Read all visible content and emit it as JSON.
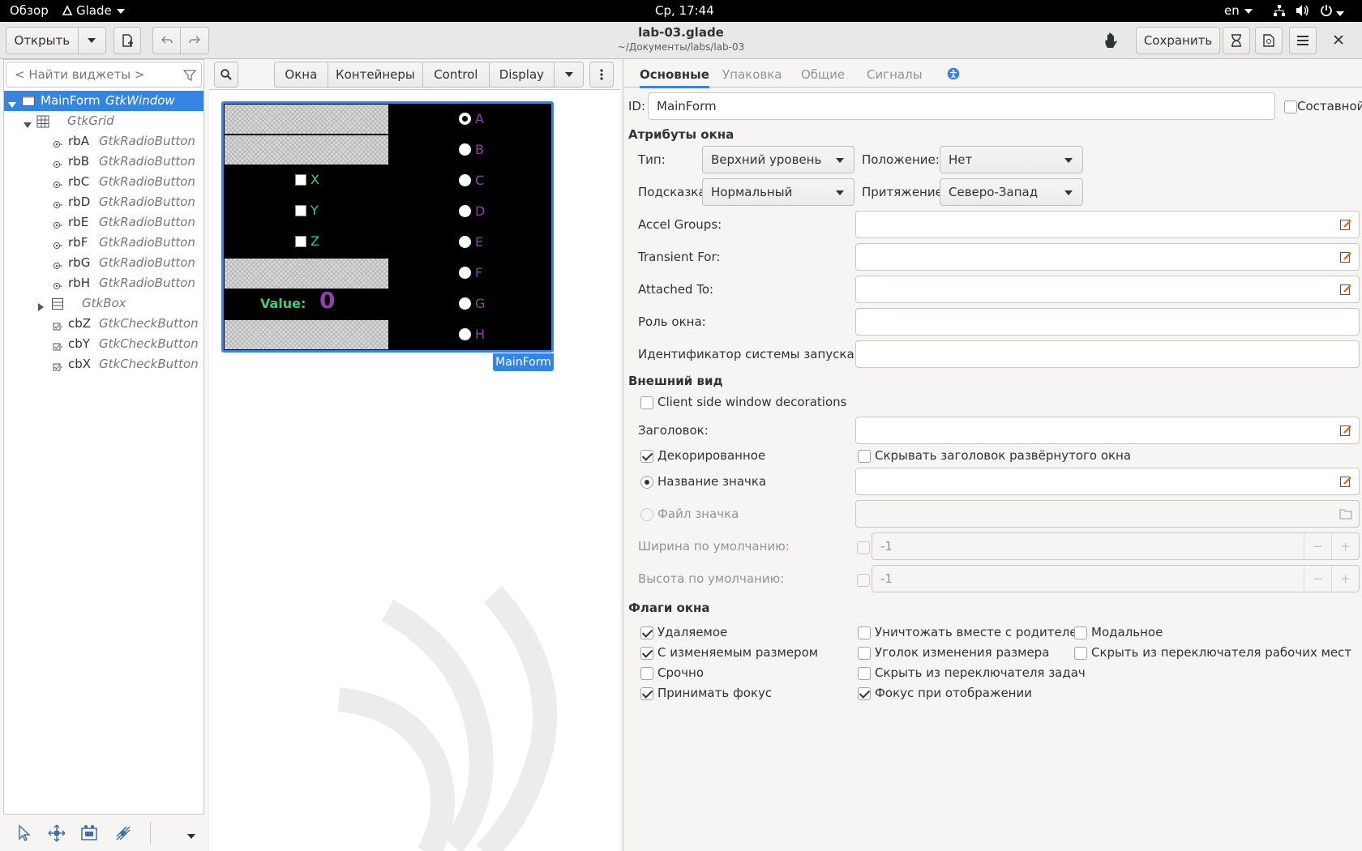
{
  "topbar": {
    "activities": "Обзор",
    "app_name": "Glade",
    "clock": "Ср, 17:44",
    "lang": "en"
  },
  "headerbar": {
    "open_label": "Открыть",
    "title": "lab-03.glade",
    "subtitle": "~/Документы/labs/lab-03",
    "save_label": "Сохранить"
  },
  "palette": {
    "search_placeholder": "< Найти виджеты >",
    "groups": [
      "Окна",
      "Контейнеры",
      "Control",
      "Display"
    ]
  },
  "tree": [
    {
      "name": "MainForm",
      "type": "GtkWindow"
    },
    {
      "name": "",
      "type": "GtkGrid"
    },
    {
      "name": "rbA",
      "type": "GtkRadioButton"
    },
    {
      "name": "rbB",
      "type": "GtkRadioButton"
    },
    {
      "name": "rbC",
      "type": "GtkRadioButton"
    },
    {
      "name": "rbD",
      "type": "GtkRadioButton"
    },
    {
      "name": "rbE",
      "type": "GtkRadioButton"
    },
    {
      "name": "rbF",
      "type": "GtkRadioButton"
    },
    {
      "name": "rbG",
      "type": "GtkRadioButton"
    },
    {
      "name": "rbH",
      "type": "GtkRadioButton"
    },
    {
      "name": "",
      "type": "GtkBox"
    },
    {
      "name": "cbZ",
      "type": "GtkCheckButton"
    },
    {
      "name": "cbY",
      "type": "GtkCheckButton"
    },
    {
      "name": "cbX",
      "type": "GtkCheckButton"
    }
  ],
  "preview": {
    "checks": [
      "X",
      "Y",
      "Z"
    ],
    "radios": [
      "A",
      "B",
      "C",
      "D",
      "E",
      "F",
      "G",
      "H"
    ],
    "value_label": "Value:",
    "value": "0",
    "window_name": "MainForm",
    "colors": {
      "check_text": "#33d17a",
      "radio_text": "#9141ac",
      "value_label": "#33d17a",
      "value_num": "#9141ac",
      "accent": "#3584e4"
    }
  },
  "props": {
    "tabs": [
      "Основные",
      "Упаковка",
      "Общие",
      "Сигналы"
    ],
    "id_label": "ID:",
    "id_value": "MainForm",
    "composite_label": "Составной",
    "window_attrs_header": "Атрибуты окна",
    "type_label": "Тип:",
    "type_value": "Верхний уровень",
    "position_label": "Положение:",
    "position_value": "Нет",
    "hint_label": "Подсказка:",
    "hint_value": "Нормальный",
    "gravity_label": "Притяжение:",
    "gravity_value": "Северо-Запад",
    "accel_groups": "Accel Groups:",
    "transient_for": "Transient For:",
    "attached_to": "Attached To:",
    "role": "Роль окна:",
    "startup_id": "Идентификатор системы запуска:",
    "appearance_header": "Внешний вид",
    "csd": "Client side window decorations",
    "title_label": "Заголовок:",
    "decorated": "Декорированное",
    "hide_titlebar": "Скрывать заголовок развёрнутого окна",
    "icon_name": "Название значка",
    "icon_file": "Файл значка",
    "default_width": "Ширина по умолчанию:",
    "default_height": "Высота по умолчанию:",
    "default_value": "-1",
    "flags_header": "Флаги окна",
    "flags": {
      "deletable": "Удаляемое",
      "destroy_with_parent": "Уничтожать вместе с родителем",
      "modal": "Модальное",
      "resizable": "С изменяемым размером",
      "resize_grip": "Уголок изменения размера",
      "skip_pager": "Скрыть из переключателя рабочих мест",
      "urgent": "Срочно",
      "skip_taskbar": "Скрыть из переключателя задач",
      "accept_focus": "Принимать фокус",
      "focus_on_map": "Фокус при отображении"
    }
  }
}
